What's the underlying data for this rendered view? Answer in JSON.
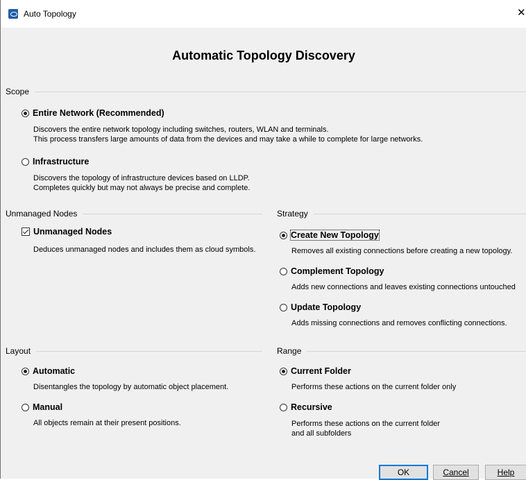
{
  "window": {
    "title": "Auto Topology",
    "close_glyph": "✕",
    "icon": "eye-app-icon"
  },
  "dialog_title": "Automatic Topology Discovery",
  "scope": {
    "label": "Scope",
    "options": [
      {
        "label": "Entire Network (Recommended)",
        "selected": true,
        "desc": [
          "Discovers the entire network topology including switches, routers, WLAN and terminals.",
          "This process transfers large amounts of data from the devices and may take a while to complete for large networks."
        ]
      },
      {
        "label": "Infrastructure",
        "selected": false,
        "desc": [
          "Discovers the topology of infrastructure devices based on LLDP.",
          "Completes quickly but may not always be precise and complete."
        ]
      }
    ]
  },
  "unmanaged": {
    "label": "Unmanaged Nodes",
    "checkbox": {
      "label": "Unmanaged Nodes",
      "checked": true,
      "desc": "Deduces unmanaged nodes and includes them as cloud symbols."
    }
  },
  "strategy": {
    "label": "Strategy",
    "options": [
      {
        "label": "Create New Topology",
        "selected": true,
        "desc": "Removes all existing connections before creating a new topology."
      },
      {
        "label": "Complement Topology",
        "selected": false,
        "desc": "Adds new connections and leaves existing connections untouched"
      },
      {
        "label": "Update Topology",
        "selected": false,
        "desc": "Adds missing connections and removes conflicting connections."
      }
    ]
  },
  "layout": {
    "label": "Layout",
    "options": [
      {
        "label": "Automatic",
        "selected": true,
        "desc": "Disentangles the topology by automatic object placement."
      },
      {
        "label": "Manual",
        "selected": false,
        "desc": "All objects remain at their present positions."
      }
    ]
  },
  "range": {
    "label": "Range",
    "options": [
      {
        "label": "Current Folder",
        "selected": true,
        "desc": [
          "Performs these actions on the current folder only"
        ]
      },
      {
        "label": "Recursive",
        "selected": false,
        "desc": [
          "Performs these actions on the current folder",
          "and all subfolders"
        ]
      }
    ]
  },
  "buttons": {
    "ok": "OK",
    "cancel": "Cancel",
    "help": "Help"
  }
}
